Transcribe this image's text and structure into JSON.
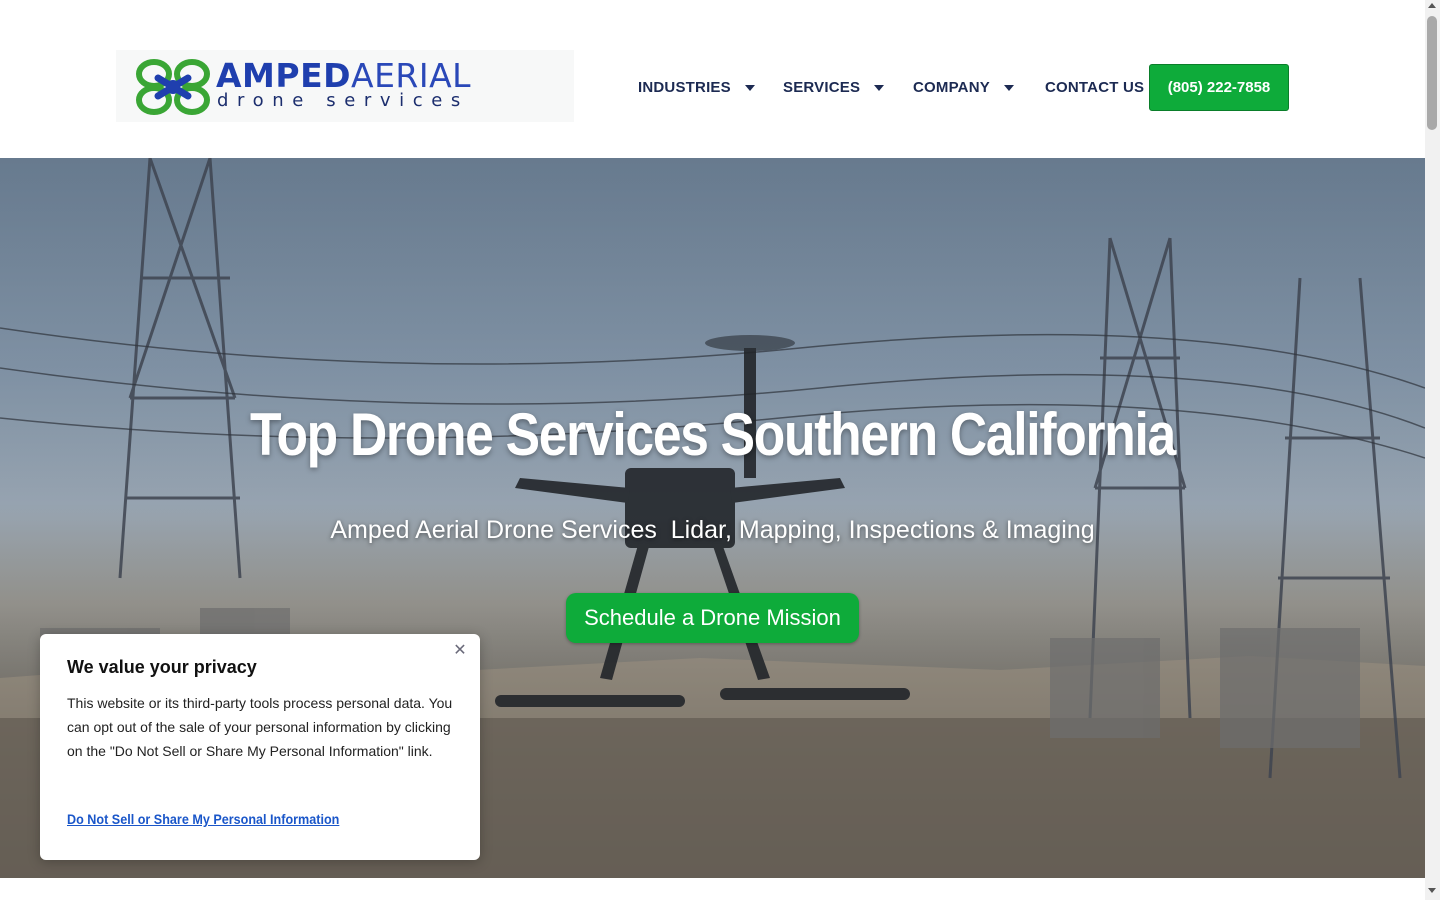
{
  "logo": {
    "brand_part1": "AMPED",
    "brand_part2": "AERIAL",
    "tagline": "drone services",
    "colors": {
      "green": "#3aa635",
      "blue": "#1f3fae"
    }
  },
  "nav": {
    "items": [
      {
        "label": "INDUSTRIES",
        "has_dropdown": true
      },
      {
        "label": "SERVICES",
        "has_dropdown": true
      },
      {
        "label": "COMPANY",
        "has_dropdown": true
      },
      {
        "label": "CONTACT US",
        "has_dropdown": false
      }
    ],
    "phone_button": "(805) 222-7858"
  },
  "hero": {
    "title": "Top Drone Services Southern California",
    "subtitle": "Amped Aerial Drone Services  Lidar, Mapping, Inspections & Imaging",
    "cta_label": "Schedule a Drone Mission"
  },
  "privacy": {
    "title": "We value your privacy",
    "text": "This website or its third-party tools process personal data. You can opt out of the sale of your personal information by clicking on the \"Do Not Sell or Share My Personal Information\" link.",
    "link": "Do Not Sell or Share My Personal Information",
    "close_icon": "close-icon"
  },
  "colors": {
    "accent_green": "#0eab3a",
    "nav_text": "#1c2a52",
    "link_blue": "#1a56c9"
  }
}
